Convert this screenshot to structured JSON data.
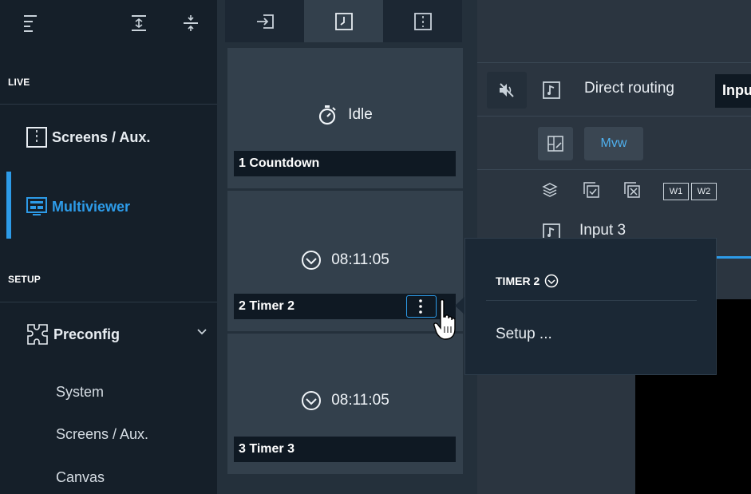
{
  "sidebar": {
    "sections": {
      "live": "LIVE",
      "setup": "SETUP"
    },
    "items": {
      "screens_aux": "Screens / Aux.",
      "multiviewer": "Multiviewer",
      "preconfig": "Preconfig"
    },
    "subitems": [
      "System",
      "Screens / Aux.",
      "Canvas"
    ],
    "active_color": "#2d9be8"
  },
  "widgets": [
    {
      "label": "1 Countdown",
      "status": "Idle",
      "status_icon": "stopwatch-icon"
    },
    {
      "label": "2 Timer 2",
      "status": "08:11:05",
      "status_icon": "clock-chevron-icon"
    },
    {
      "label": "3 Timer 3",
      "status": "08:11:05",
      "status_icon": "clock-chevron-icon"
    }
  ],
  "toolbar": {
    "direct_routing": "Direct routing",
    "input_partial": "Inpu",
    "mvw": "Mvw",
    "w1": "W1",
    "w2": "W2",
    "input3": "Input 3"
  },
  "popup": {
    "title": "TIMER 2",
    "menu_item": "Setup ..."
  }
}
